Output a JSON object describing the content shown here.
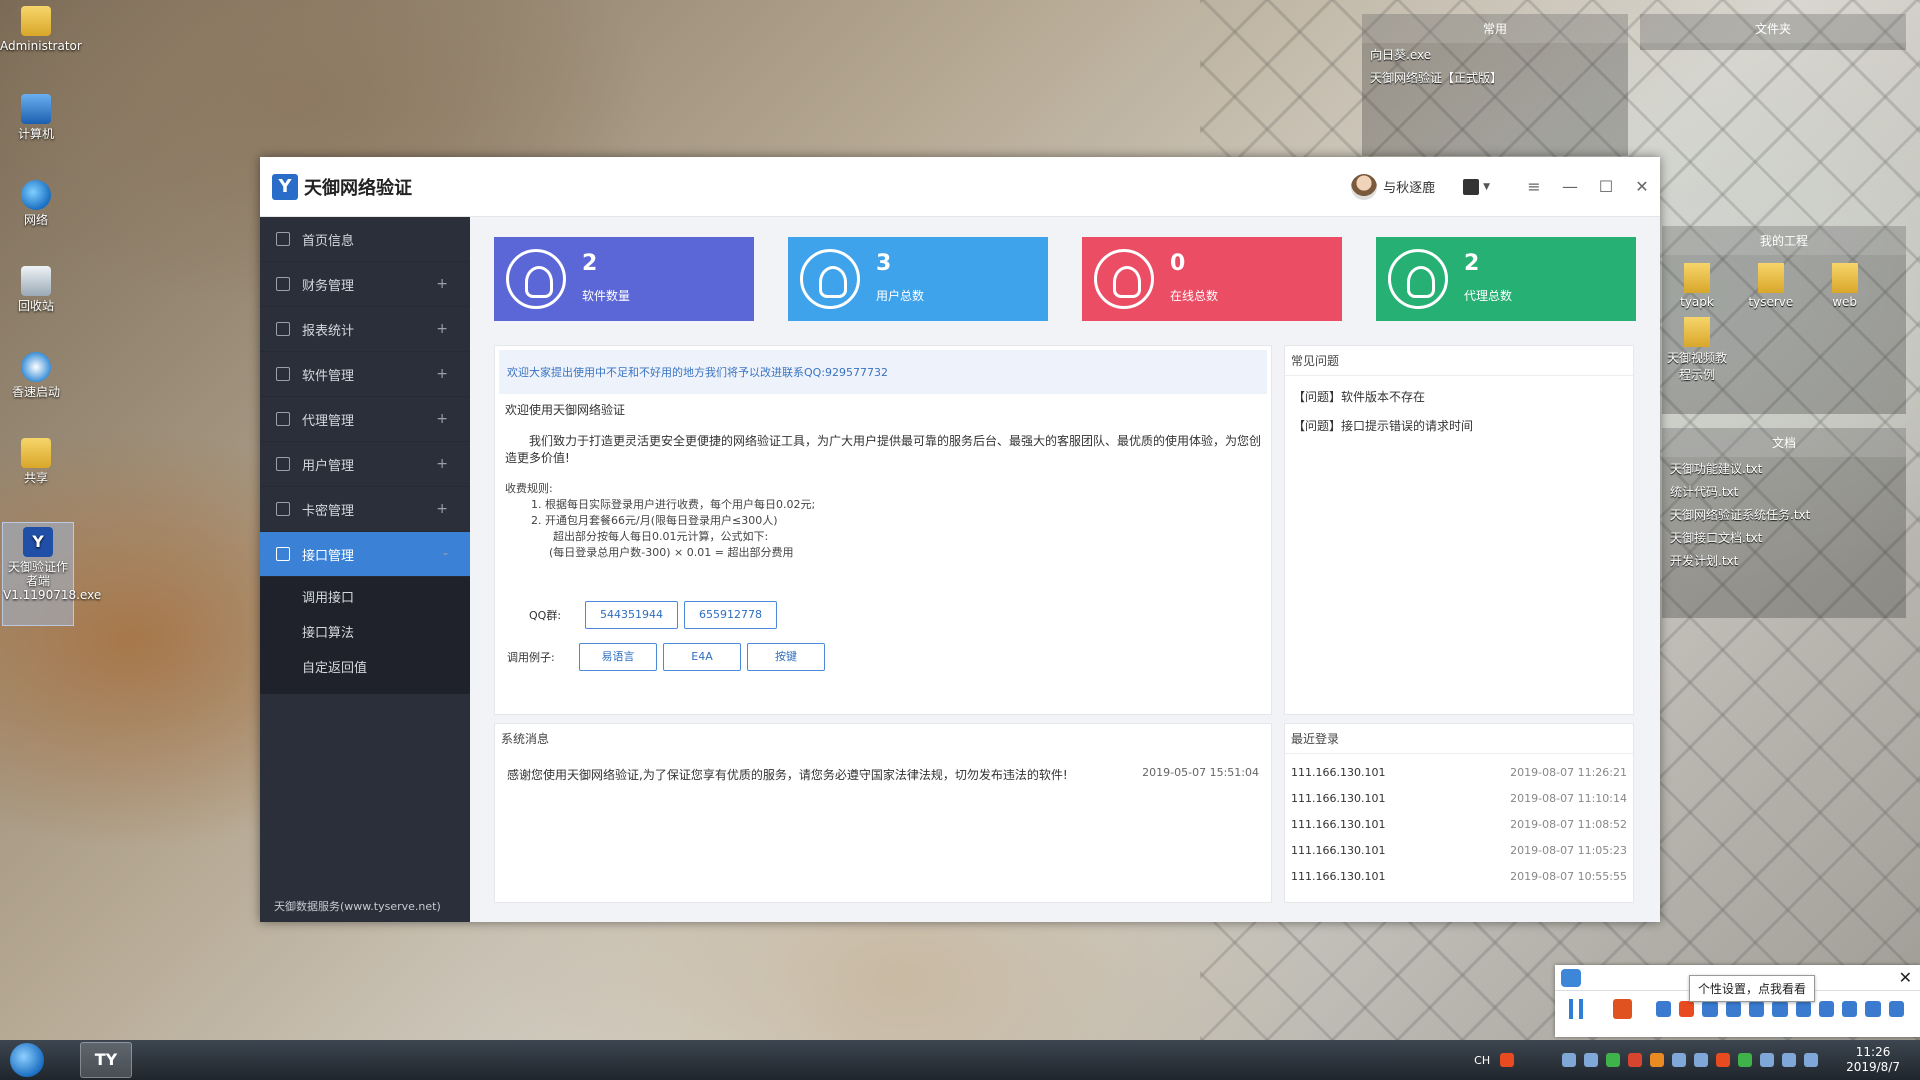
{
  "desktop": {
    "icons": [
      {
        "label": "Administrator"
      },
      {
        "label": "计算机"
      },
      {
        "label": "网络"
      },
      {
        "label": "回收站"
      },
      {
        "label": "香速启动"
      },
      {
        "label": "共享"
      },
      {
        "label": "天御验证作者端V1.1190718.exe"
      }
    ],
    "panels": {
      "common": {
        "title": "常用",
        "items": [
          "向日葵.exe",
          "天御网络验证【正式版】"
        ]
      },
      "folder": {
        "title": "文件夹"
      },
      "project": {
        "title": "我的工程",
        "folders": [
          "tyapk",
          "tyserve",
          "web",
          "天御视频教程示例"
        ]
      },
      "docs": {
        "title": "文档",
        "items": [
          "天御功能建议.txt",
          "统计代码.txt",
          "天御网络验证系统任务.txt",
          "天御接口文档.txt",
          "开发计划.txt"
        ]
      }
    }
  },
  "window": {
    "app_title": "天御网络验证",
    "user_name": "与秋逐鹿",
    "controls": {
      "menu": "≡",
      "minimize": "—",
      "maximize": "☐",
      "close": "✕"
    }
  },
  "sidebar": {
    "items": [
      {
        "label": "首页信息",
        "expand": ""
      },
      {
        "label": "财务管理",
        "expand": "+"
      },
      {
        "label": "报表统计",
        "expand": "+"
      },
      {
        "label": "软件管理",
        "expand": "+"
      },
      {
        "label": "代理管理",
        "expand": "+"
      },
      {
        "label": "用户管理",
        "expand": "+"
      },
      {
        "label": "卡密管理",
        "expand": "+"
      },
      {
        "label": "接口管理",
        "expand": "-"
      }
    ],
    "sub_items": [
      "调用接口",
      "接口算法",
      "自定返回值"
    ],
    "footer": "天御数据服务(www.tyserve.net)"
  },
  "stats": [
    {
      "value": "2",
      "label": "软件数量",
      "color": "#5b67d6"
    },
    {
      "value": "3",
      "label": "用户总数",
      "color": "#3fa3ec"
    },
    {
      "value": "0",
      "label": "在线总数",
      "color": "#ea4d64"
    },
    {
      "value": "2",
      "label": "代理总数",
      "color": "#27b074"
    }
  ],
  "main_card": {
    "notice": "欢迎大家提出使用中不足和不好用的地方我们将予以改进联系QQ:929577732",
    "welcome_title": "欢迎使用天御网络验证",
    "welcome_body": "我们致力于打造更灵活更安全更便捷的网络验证工具，为广大用户提供最可靠的服务后台、最强大的客服团队、最优质的使用体验，为您创造更多价值!",
    "rules_title": "收费规则:",
    "rule_1": "1. 根据每日实际登录用户进行收费，每个用户每日0.02元;",
    "rule_2": "2. 开通包月套餐66元/月(限每日登录用户≤300人)",
    "rule_2a": "超出部分按每人每日0.01元计算，公式如下:",
    "rule_2b": "(每日登录总用户数-300) × 0.01 = 超出部分费用",
    "qq_label": "QQ群:",
    "qq_groups": [
      "544351944",
      "655912778"
    ],
    "example_label": "调用例子:",
    "examples": [
      "易语言",
      "E4A",
      "按键"
    ]
  },
  "faq": {
    "title": "常见问题",
    "items": [
      "【问题】软件版本不存在",
      "【问题】接口提示错误的请求时间"
    ]
  },
  "system_msg": {
    "title": "系统消息",
    "text": "感谢您使用天御网络验证,为了保证您享有优质的服务，请您务必遵守国家法律法规，切勿发布违法的软件!",
    "time": "2019-05-07 15:51:04"
  },
  "recent_login": {
    "title": "最近登录",
    "rows": [
      {
        "ip": "111.166.130.101",
        "time": "2019-08-07 11:26:21"
      },
      {
        "ip": "111.166.130.101",
        "time": "2019-08-07 11:10:14"
      },
      {
        "ip": "111.166.130.101",
        "time": "2019-08-07 11:08:52"
      },
      {
        "ip": "111.166.130.101",
        "time": "2019-08-07 11:05:23"
      },
      {
        "ip": "111.166.130.101",
        "time": "2019-08-07 10:55:55"
      }
    ]
  },
  "recorder": {
    "tooltip": "个性设置，点我看看",
    "close": "✕"
  },
  "taskbar": {
    "app": "TY",
    "lang": "CH",
    "time": "11:26",
    "date": "2019/8/7"
  }
}
